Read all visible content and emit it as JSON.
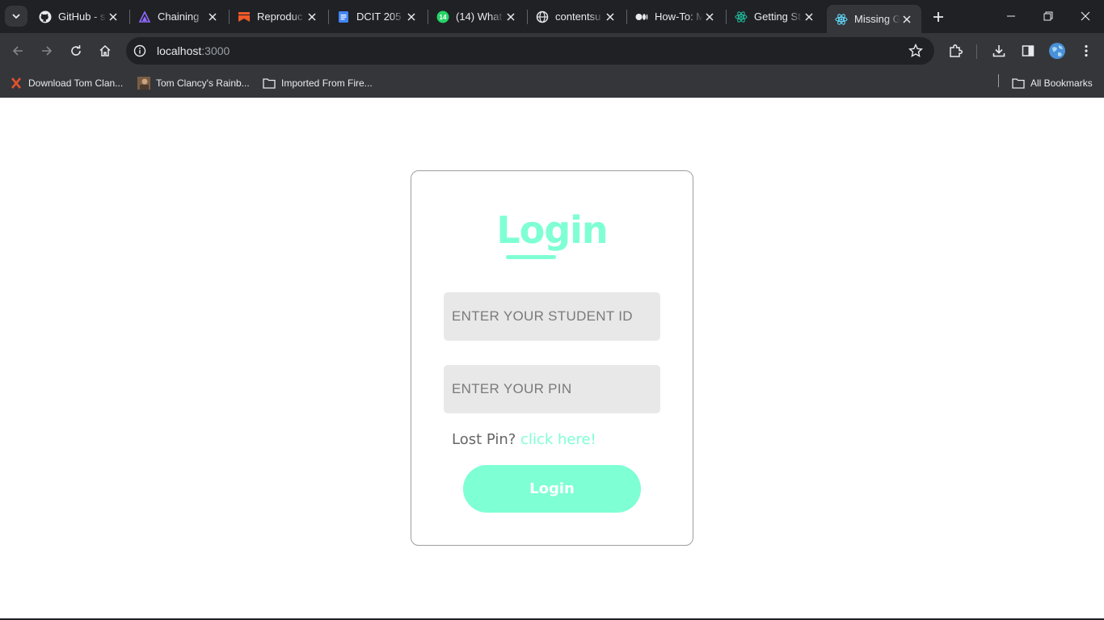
{
  "browser": {
    "tabs": [
      {
        "title": "GitHub - s",
        "icon": "github-icon"
      },
      {
        "title": "Chaining ",
        "icon": "triangle-logo-icon"
      },
      {
        "title": "Reproduc",
        "icon": "bookmark-ribbon-icon"
      },
      {
        "title": "DCIT 205 ",
        "icon": "google-docs-icon"
      },
      {
        "title": "(14) What",
        "icon": "whatsapp-icon",
        "badge": "14"
      },
      {
        "title": "contentsu",
        "icon": "globe-icon"
      },
      {
        "title": "How-To: M",
        "icon": "medium-icon"
      },
      {
        "title": "Getting St",
        "icon": "react-icon"
      },
      {
        "title": "Missing G",
        "icon": "react-icon",
        "active": true
      }
    ],
    "url_host": "localhost",
    "url_port": ":3000",
    "bookmarks": [
      {
        "label": "Download Tom Clan...",
        "icon": "x-logo-icon"
      },
      {
        "label": "Tom Clancy's Rainb...",
        "icon": "game-thumbnail-icon"
      },
      {
        "label": "Imported From Fire...",
        "icon": "folder-icon"
      }
    ],
    "all_bookmarks_label": "All Bookmarks",
    "colors": {
      "tabbar": "#202124",
      "toolbar": "#35363a"
    }
  },
  "login": {
    "title": "Login",
    "student_id_placeholder": "ENTER YOUR STUDENT ID",
    "pin_placeholder": "ENTER YOUR PIN",
    "lost_pin_text": "Lost Pin?",
    "lost_pin_link": "click here!",
    "button_label": "Login",
    "accent_color": "#7fffd4"
  }
}
